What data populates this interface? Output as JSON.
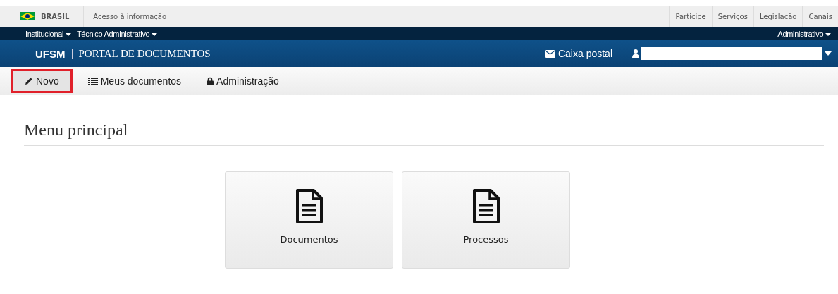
{
  "gov_bar": {
    "country": "BRASIL",
    "left_links": [
      "Acesso à informação"
    ],
    "right_links": [
      "Participe",
      "Serviços",
      "Legislação",
      "Canais"
    ]
  },
  "context_bar": {
    "left_menus": [
      "Institucional",
      "Técnico Administrativo"
    ],
    "right_menu": "Administrativo"
  },
  "header": {
    "brand": "UFSM",
    "title": "PORTAL DE DOCUMENTOS",
    "mail_link": "Caixa postal"
  },
  "nav": [
    {
      "label": "Novo",
      "highlighted": true
    },
    {
      "label": "Meus documentos",
      "highlighted": false
    },
    {
      "label": "Administração",
      "highlighted": false
    }
  ],
  "page_title": "Menu principal",
  "tiles": [
    {
      "label": "Documentos"
    },
    {
      "label": "Processos"
    }
  ]
}
